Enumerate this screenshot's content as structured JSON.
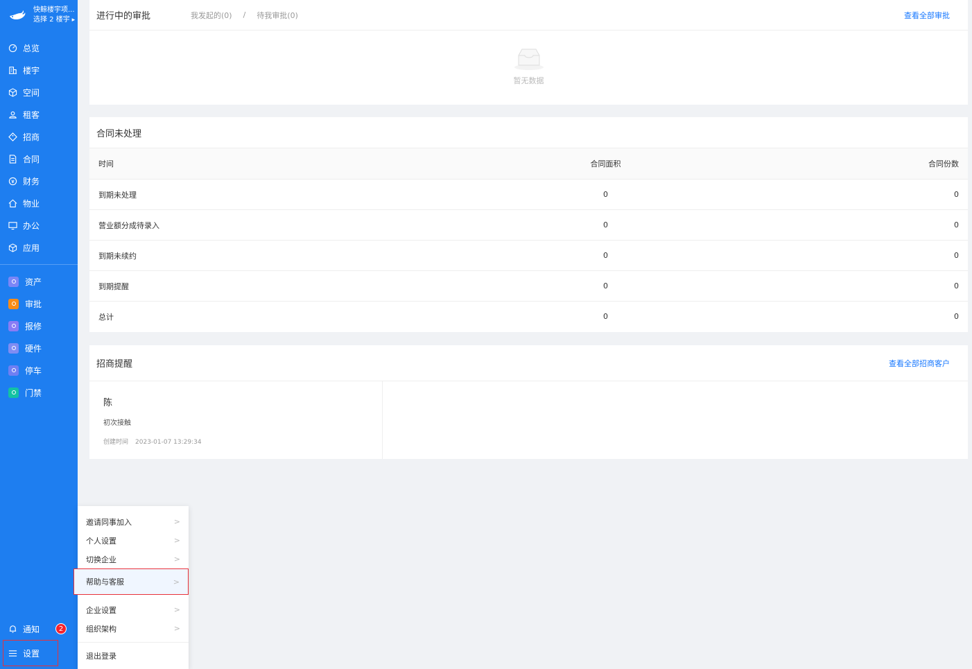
{
  "sidebar": {
    "brand_name": "快鲸楼宇项...",
    "brand_sub": "选择 2 楼宇",
    "nav": [
      {
        "label": "总览",
        "icon": "dashboard-icon"
      },
      {
        "label": "楼宇",
        "icon": "building-icon"
      },
      {
        "label": "空间",
        "icon": "cube-icon"
      },
      {
        "label": "租客",
        "icon": "tenant-icon"
      },
      {
        "label": "招商",
        "icon": "tag-icon"
      },
      {
        "label": "合同",
        "icon": "document-icon"
      },
      {
        "label": "财务",
        "icon": "coin-icon"
      },
      {
        "label": "物业",
        "icon": "home-icon"
      },
      {
        "label": "办公",
        "icon": "monitor-icon"
      },
      {
        "label": "应用",
        "icon": "app-cube-icon"
      }
    ],
    "apps": [
      {
        "label": "资产",
        "color": "#7b86f7"
      },
      {
        "label": "审批",
        "color": "#fa8c16"
      },
      {
        "label": "报修",
        "color": "#8a7cf5"
      },
      {
        "label": "硬件",
        "color": "#7f8cf3"
      },
      {
        "label": "停车",
        "color": "#6f7ff3"
      },
      {
        "label": "门禁",
        "color": "#13c2a3"
      }
    ],
    "notify_label": "通知",
    "notify_count": "2",
    "settings_label": "设置"
  },
  "popup": {
    "items": [
      "邀请同事加入",
      "个人设置",
      "切换企业",
      "帮助与客服",
      "企业设置",
      "组织架构"
    ],
    "logout": "退出登录"
  },
  "approval": {
    "title": "进行中的审批",
    "tab_initiated": "我发起的(0)",
    "separator": "/",
    "tab_pending": "待我审批(0)",
    "view_all": "查看全部审批",
    "empty": "暂无数据"
  },
  "contracts": {
    "title": "合同未处理",
    "headers": [
      "时间",
      "合同面积",
      "合同份数"
    ],
    "rows": [
      [
        "到期未处理",
        "0",
        "0"
      ],
      [
        "营业额分成待录入",
        "0",
        "0"
      ],
      [
        "到期未续约",
        "0",
        "0"
      ],
      [
        "到期提醒",
        "0",
        "0"
      ],
      [
        "总计",
        "0",
        "0"
      ]
    ]
  },
  "leasing": {
    "title": "招商提醒",
    "view_all": "查看全部招商客户",
    "card": {
      "name": "陈",
      "status": "初次接触",
      "time_label": "创建时间",
      "time_value": "2023-01-07 13:29:34"
    }
  }
}
